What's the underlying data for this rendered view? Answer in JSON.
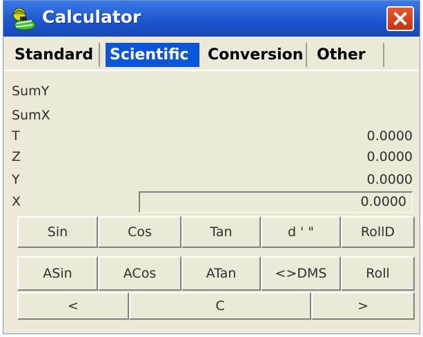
{
  "window": {
    "title": "Calculator",
    "close_icon": "close-icon"
  },
  "tabs": [
    {
      "label": "Standard",
      "active": false
    },
    {
      "label": "Scientific",
      "active": true
    },
    {
      "label": "Conversion",
      "active": false
    },
    {
      "label": "Other",
      "active": false
    }
  ],
  "registers": {
    "sumy": {
      "label": "SumY",
      "value": ""
    },
    "sumx": {
      "label": "SumX",
      "value": ""
    },
    "t": {
      "label": "T",
      "value": "0.0000"
    },
    "z": {
      "label": "Z",
      "value": "0.0000"
    },
    "y": {
      "label": "Y",
      "value": "0.0000"
    },
    "x": {
      "label": "X",
      "value": "0.0000"
    }
  },
  "buttons": {
    "row1": [
      "Sin",
      "Cos",
      "Tan",
      "d ' \"",
      "RollD"
    ],
    "row2": [
      "ASin",
      "ACos",
      "ATan",
      "<>DMS",
      "Roll"
    ],
    "row3": [
      "<",
      "C",
      ">"
    ]
  },
  "colors": {
    "titlebar": "#1e56d0",
    "active_tab": "#0a55d8",
    "close": "#d9411d",
    "window_bg": "#ece9d8"
  }
}
